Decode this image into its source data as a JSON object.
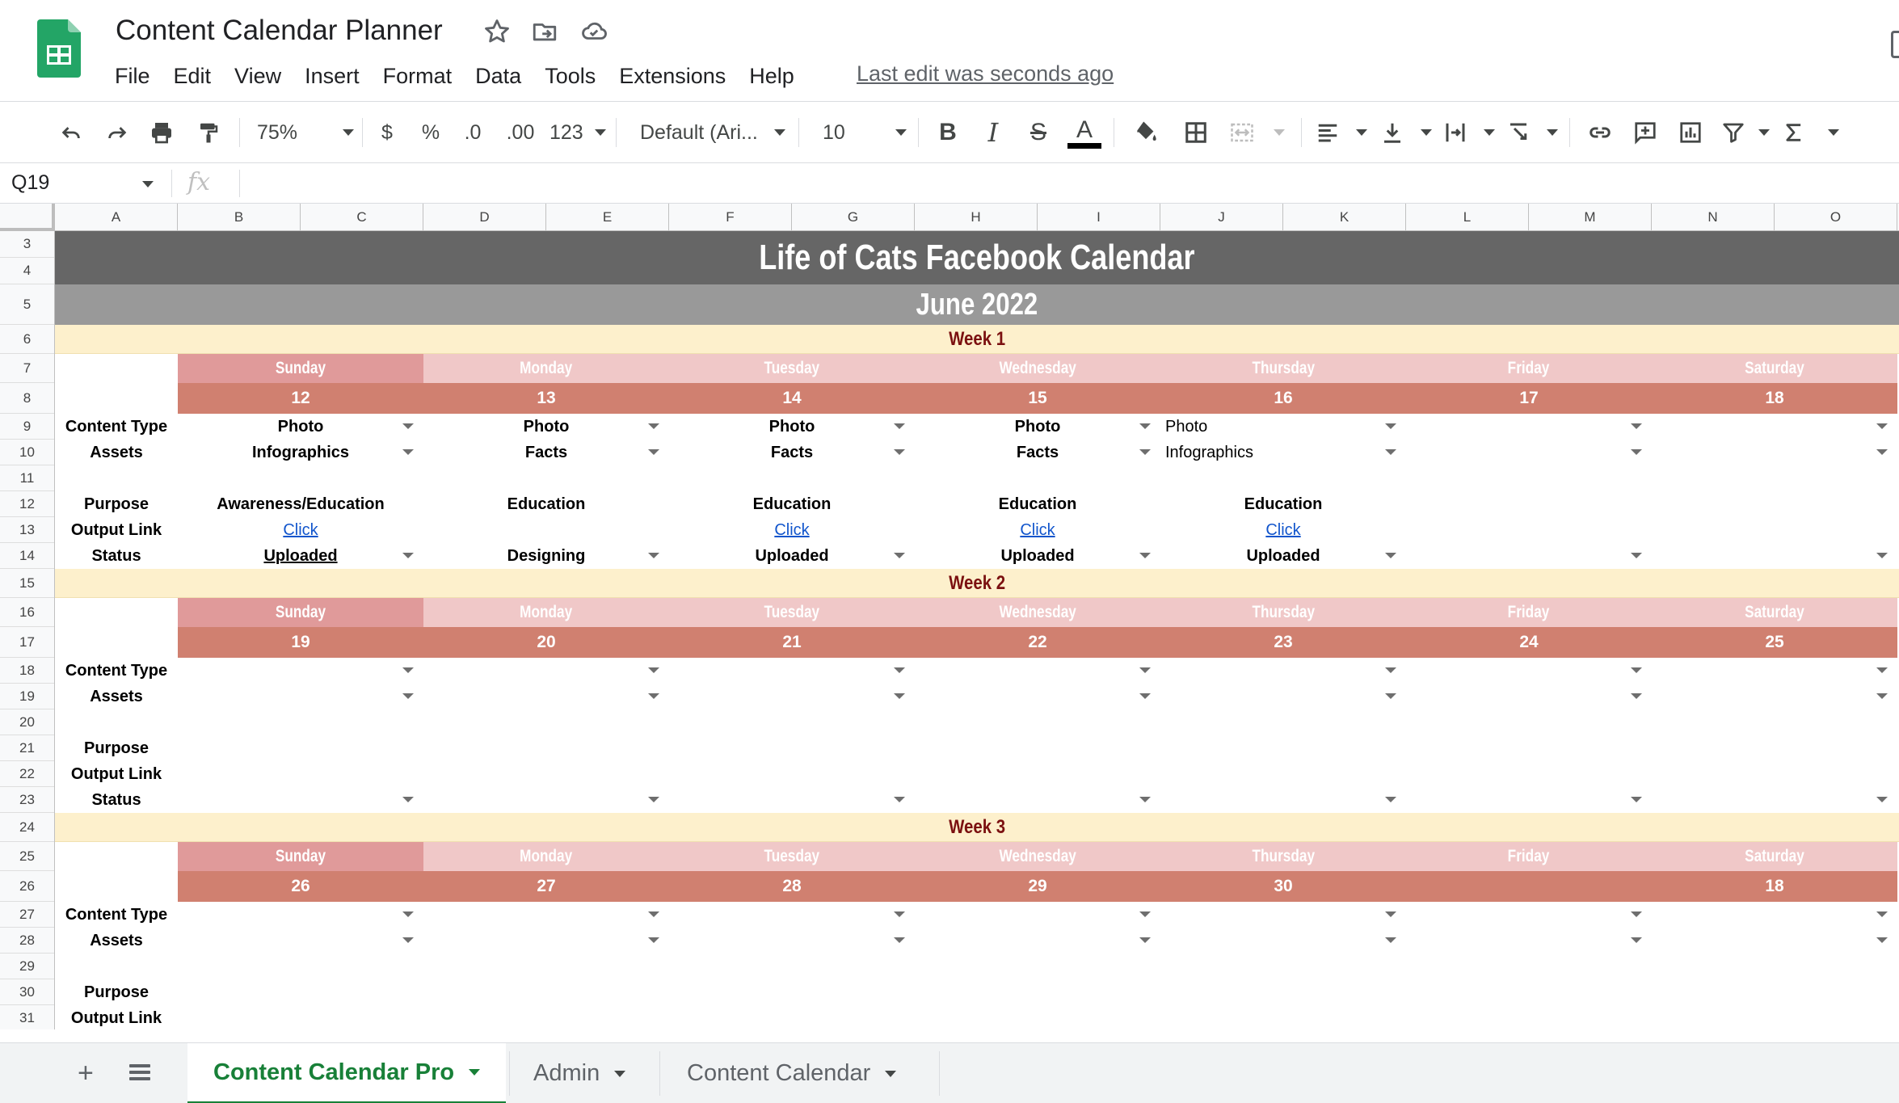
{
  "doc": {
    "title": "Content Calendar Planner",
    "last_edit": "Last edit was seconds ago",
    "menu": [
      "File",
      "Edit",
      "View",
      "Insert",
      "Format",
      "Data",
      "Tools",
      "Extensions",
      "Help"
    ]
  },
  "toolbar": {
    "zoom": "75%",
    "currency": "$",
    "percent": "%",
    "decrease_decimal": ".0",
    "increase_decimal": ".00",
    "more_formats": "123",
    "font": "Default (Ari...",
    "font_size": "10",
    "bold": "B",
    "italic": "I",
    "strike": "S",
    "text_color": "A"
  },
  "formula_bar": {
    "cell_ref": "Q19",
    "fx": "fx",
    "content": ""
  },
  "columns": [
    "A",
    "B",
    "C",
    "D",
    "E",
    "F",
    "G",
    "H",
    "I",
    "J",
    "K",
    "L",
    "M",
    "N",
    "O"
  ],
  "rows": [
    "3",
    "4",
    "5",
    "6",
    "7",
    "8",
    "9",
    "10",
    "11",
    "12",
    "13",
    "14",
    "15",
    "16",
    "17",
    "18",
    "19",
    "20",
    "21",
    "22",
    "23",
    "24",
    "25",
    "26",
    "27",
    "28",
    "29",
    "30",
    "31"
  ],
  "sheet": {
    "title": "Life of Cats Facebook Calendar",
    "subtitle": "June 2022",
    "days": [
      "Sunday",
      "Monday",
      "Tuesday",
      "Wednesday",
      "Thursday",
      "Friday",
      "Saturday"
    ],
    "row_labels": {
      "content_type": "Content Type",
      "assets": "Assets",
      "purpose": "Purpose",
      "output_link": "Output Link",
      "status": "Status"
    },
    "weeks": [
      {
        "label": "Week 1",
        "dates": [
          "12",
          "13",
          "14",
          "15",
          "16",
          "17",
          "18"
        ],
        "content_type": [
          "Photo",
          "Photo",
          "Photo",
          "Photo",
          "Photo",
          "",
          ""
        ],
        "assets": [
          "Infographics",
          "Facts",
          "Facts",
          "Facts",
          "Infographics",
          "",
          ""
        ],
        "purpose": [
          "Awareness/Education",
          "Education",
          "Education",
          "Education",
          "Education",
          "",
          ""
        ],
        "output_link": [
          "Click",
          "",
          "Click",
          "Click",
          "Click",
          "",
          ""
        ],
        "status": [
          "Uploaded",
          "Designing",
          "Uploaded",
          "Uploaded",
          "Uploaded",
          "",
          ""
        ]
      },
      {
        "label": "Week 2",
        "dates": [
          "19",
          "20",
          "21",
          "22",
          "23",
          "24",
          "25"
        ]
      },
      {
        "label": "Week 3",
        "dates": [
          "26",
          "27",
          "28",
          "29",
          "30",
          "",
          "18"
        ]
      }
    ]
  },
  "colors": {
    "title_band": "#666666",
    "subtitle_band": "#999999",
    "week_band": "#fdf0cc",
    "sunday": "#e09a9a",
    "weekday": "#f0c8c8",
    "date_row": "#d08070",
    "week_text": "#7b1010",
    "link": "#1155cc",
    "active_tab": "#188038"
  },
  "tabs": [
    "Content Calendar Pro",
    "Admin",
    "Content Calendar"
  ],
  "icons": [
    "sheets-logo-icon",
    "star-icon",
    "move-icon",
    "cloud-status-icon",
    "undo-icon",
    "redo-icon",
    "print-icon",
    "paint-format-icon",
    "fill-color-icon",
    "borders-icon",
    "merge-cells-icon",
    "align-icon",
    "valign-icon",
    "wrap-icon",
    "rotate-icon",
    "link-icon",
    "comment-icon",
    "chart-icon",
    "filter-icon",
    "functions-icon"
  ]
}
